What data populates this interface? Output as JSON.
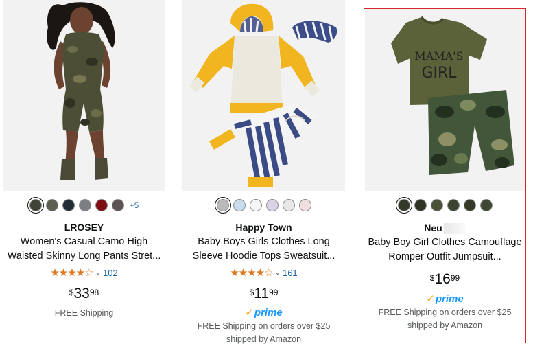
{
  "products": [
    {
      "brand": "LROSEY",
      "title_line1": "Women's Casual Camo High",
      "title_line2": "Waisted Skinny Long Pants Stret...",
      "stars": "★★★★☆",
      "rating_count": "102",
      "price_symbol": "$",
      "price_whole": "33",
      "price_fraction": "98",
      "shipping_line1": "FREE Shipping",
      "more_colors": "+5",
      "swatch_colors": [
        "#3f4434",
        "#5d5f52",
        "#222c35",
        "#7c8084",
        "#7d0f14",
        "#5e5456"
      ]
    },
    {
      "brand": "Happy Town",
      "title_line1": "Baby Boys Girls Clothes Long",
      "title_line2": "Sleeve Hoodie Tops Sweatsuit...",
      "stars": "★★★★☆",
      "rating_count": "161",
      "price_symbol": "$",
      "price_whole": "11",
      "price_fraction": "99",
      "prime_label": "prime",
      "shipping_line1": "FREE Shipping on orders over $25",
      "shipping_line2": "shipped by Amazon",
      "swatch_colors": [
        "#b9b9b9",
        "#c9dcec",
        "#f6f6f6",
        "#dcd2e6",
        "#e7e7e7",
        "#f1dfe0"
      ]
    },
    {
      "brand": "Neu",
      "title_line1": "Baby Boy Girl Clothes Camouflage",
      "title_line2": "Romper Outfit Jumpsuit...",
      "price_symbol": "$",
      "price_whole": "16",
      "price_fraction": "99",
      "prime_label": "prime",
      "shipping_line1": "FREE Shipping on orders over $25",
      "shipping_line2": "shipped by Amazon",
      "shirt_text_1": "MAMA'S",
      "shirt_text_2": "GIRL",
      "swatch_colors": [
        "#333a28",
        "#2f3322",
        "#4a5338",
        "#3a4430",
        "#343c29",
        "#3e4731"
      ]
    }
  ],
  "colors": {
    "link": "#2162a1",
    "star": "#de7921",
    "prime_blue": "#1a98ff",
    "prime_check": "#f7a21b",
    "selected_border": "#d5282d"
  }
}
